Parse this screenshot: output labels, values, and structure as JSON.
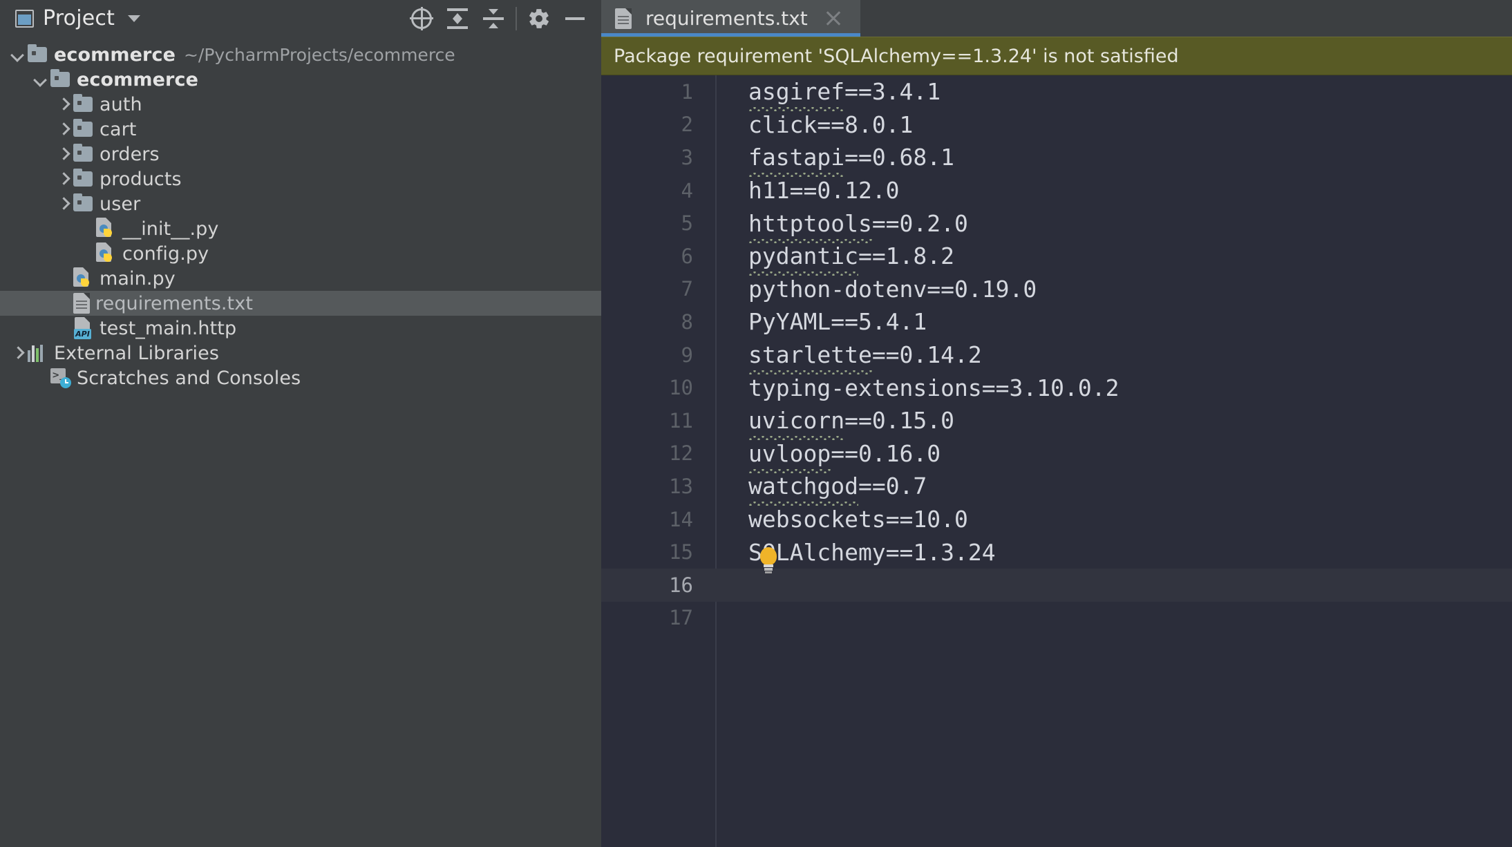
{
  "project_panel": {
    "title": "Project",
    "toolbar_buttons": [
      {
        "name": "select-opened-file-icon",
        "icon": "crosshair-icon"
      },
      {
        "name": "expand-all-icon",
        "icon": "expand-all-icon"
      },
      {
        "name": "collapse-all-icon",
        "icon": "collapse-all-icon"
      },
      {
        "name": "settings-icon",
        "icon": "gear-icon"
      },
      {
        "name": "hide-icon",
        "icon": "minus-icon"
      }
    ],
    "tree": [
      {
        "label": "ecommerce",
        "sub": "~/PycharmProjects/ecommerce",
        "icon": "folder-icon",
        "arrow": "down",
        "indent": 0,
        "style": "bold",
        "selected": false
      },
      {
        "label": "ecommerce",
        "sub": "",
        "icon": "folder-icon",
        "arrow": "down",
        "indent": 1,
        "style": "bold",
        "selected": false
      },
      {
        "label": "auth",
        "sub": "",
        "icon": "folder-icon",
        "arrow": "right",
        "indent": 2,
        "style": "normal",
        "selected": false
      },
      {
        "label": "cart",
        "sub": "",
        "icon": "folder-icon",
        "arrow": "right",
        "indent": 2,
        "style": "normal",
        "selected": false
      },
      {
        "label": "orders",
        "sub": "",
        "icon": "folder-icon",
        "arrow": "right",
        "indent": 2,
        "style": "normal",
        "selected": false
      },
      {
        "label": "products",
        "sub": "",
        "icon": "folder-icon",
        "arrow": "right",
        "indent": 2,
        "style": "normal",
        "selected": false
      },
      {
        "label": "user",
        "sub": "",
        "icon": "folder-icon",
        "arrow": "right",
        "indent": 2,
        "style": "normal",
        "selected": false
      },
      {
        "label": "__init__.py",
        "sub": "",
        "icon": "python-file-icon",
        "arrow": "none",
        "indent": 3,
        "style": "normal",
        "selected": false
      },
      {
        "label": "config.py",
        "sub": "",
        "icon": "python-file-icon",
        "arrow": "none",
        "indent": 3,
        "style": "normal",
        "selected": false
      },
      {
        "label": "main.py",
        "sub": "",
        "icon": "python-file-icon",
        "arrow": "none",
        "indent": 2,
        "style": "normal",
        "selected": false
      },
      {
        "label": "requirements.txt",
        "sub": "",
        "icon": "text-file-icon",
        "arrow": "none",
        "indent": 2,
        "style": "dim",
        "selected": true
      },
      {
        "label": "test_main.http",
        "sub": "",
        "icon": "http-file-icon",
        "arrow": "none",
        "indent": 2,
        "style": "normal",
        "selected": false
      },
      {
        "label": "External Libraries",
        "sub": "",
        "icon": "libraries-icon",
        "arrow": "right",
        "indent": 0,
        "style": "normal",
        "selected": false
      },
      {
        "label": "Scratches and Consoles",
        "sub": "",
        "icon": "scratches-icon",
        "arrow": "none",
        "indent": 1,
        "style": "normal",
        "selected": false
      }
    ]
  },
  "editor": {
    "tab": {
      "label": "requirements.txt",
      "icon": "text-file-icon",
      "close_icon": "close-icon"
    },
    "warning": "Package requirement 'SQLAlchemy==1.3.24' is not satisfied",
    "bulb_icon": "lightbulb-icon",
    "lines": [
      {
        "num": "1",
        "pkg": "asgiref",
        "rest": "==3.4.1",
        "squiggle": true,
        "current": false
      },
      {
        "num": "2",
        "pkg": "click",
        "rest": "==8.0.1",
        "squiggle": false,
        "current": false
      },
      {
        "num": "3",
        "pkg": "fastapi",
        "rest": "==0.68.1",
        "squiggle": true,
        "current": false
      },
      {
        "num": "4",
        "pkg": "h11",
        "rest": "==0.12.0",
        "squiggle": false,
        "current": false
      },
      {
        "num": "5",
        "pkg": "httptools",
        "rest": "==0.2.0",
        "squiggle": true,
        "current": false
      },
      {
        "num": "6",
        "pkg": "pydantic",
        "rest": "==1.8.2",
        "squiggle": true,
        "current": false
      },
      {
        "num": "7",
        "pkg": "python-dotenv",
        "rest": "==0.19.0",
        "squiggle": false,
        "current": false
      },
      {
        "num": "8",
        "pkg": "PyYAML",
        "rest": "==5.4.1",
        "squiggle": false,
        "current": false
      },
      {
        "num": "9",
        "pkg": "starlette",
        "rest": "==0.14.2",
        "squiggle": true,
        "current": false
      },
      {
        "num": "10",
        "pkg": "typing-extensions",
        "rest": "==3.10.0.2",
        "squiggle": false,
        "current": false
      },
      {
        "num": "11",
        "pkg": "uvicorn",
        "rest": "==0.15.0",
        "squiggle": true,
        "current": false
      },
      {
        "num": "12",
        "pkg": "uvloop",
        "rest": "==0.16.0",
        "squiggle": true,
        "current": false
      },
      {
        "num": "13",
        "pkg": "watchgod",
        "rest": "==0.7",
        "squiggle": true,
        "current": false
      },
      {
        "num": "14",
        "pkg": "websockets",
        "rest": "==10.0",
        "squiggle": false,
        "current": false
      },
      {
        "num": "15",
        "pkg": "SQLAlchemy",
        "rest": "==1.3.24",
        "squiggle": false,
        "current": false
      },
      {
        "num": "16",
        "pkg": "",
        "rest": "",
        "squiggle": false,
        "current": true
      },
      {
        "num": "17",
        "pkg": "",
        "rest": "",
        "squiggle": false,
        "current": false
      }
    ]
  },
  "colors": {
    "panel_bg": "#3c3f41",
    "editor_bg": "#2b2d3a",
    "warning_bg": "#585a25",
    "tab_accent": "#4a88c7",
    "selection_bg": "#55595b",
    "bulb": "#f0b429"
  }
}
